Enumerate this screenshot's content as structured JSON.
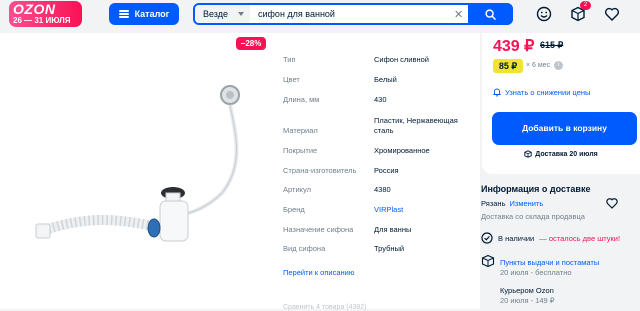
{
  "header": {
    "logo_brand": "OZON",
    "logo_dates": "26 — 31 ИЮЛЯ",
    "catalog_label": "Каталог",
    "search_scope": "Везде",
    "search_query": "сифон для ванной",
    "cart_count": "2"
  },
  "product": {
    "discount": "−28%",
    "specs": [
      {
        "key": "Тип",
        "value": "Сифон сливной"
      },
      {
        "key": "Цвет",
        "value": "Белый"
      },
      {
        "key": "Длина, мм",
        "value": "430"
      },
      {
        "key": "Материал",
        "value": "Пластик, Нержавеющая сталь"
      },
      {
        "key": "Покрытие",
        "value": "Хромированное"
      },
      {
        "key": "Страна-изготовитель",
        "value": "Россия"
      },
      {
        "key": "Артикул",
        "value": "4380"
      },
      {
        "key": "Бренд",
        "value": "VIRPlast"
      },
      {
        "key": "Назначение сифона",
        "value": "Для ванны"
      },
      {
        "key": "Вид сифона",
        "value": "Трубный"
      }
    ],
    "to_description": "Перейти к описанию",
    "faint_text": "Сравнить 4 товара (4382)"
  },
  "buybox": {
    "price": "439 ₽",
    "old_price": "615 ₽",
    "split_price": "85 ₽",
    "split_term": "× 6 мес",
    "notify": "Узнать о снижении цены",
    "add_to_cart": "Добавить в корзину",
    "delivery": "Доставка 20 июля"
  },
  "delivery": {
    "title": "Информация о доставке",
    "city": "Рязань",
    "change": "Изменить",
    "from_warehouse": "Доставка со склада продавца",
    "in_stock": "В наличии",
    "stock_warning": "— осталось две штуки!",
    "pickup": "Пункты выдачи и постаматы",
    "pickup_sub": "20 июля - бесплатно",
    "courier": "Курьером Ozon",
    "courier_sub": "20 июля - 149 ₽"
  },
  "colors": {
    "accent": "#005bff",
    "sale": "#f91155",
    "split": "#f1e32f"
  }
}
